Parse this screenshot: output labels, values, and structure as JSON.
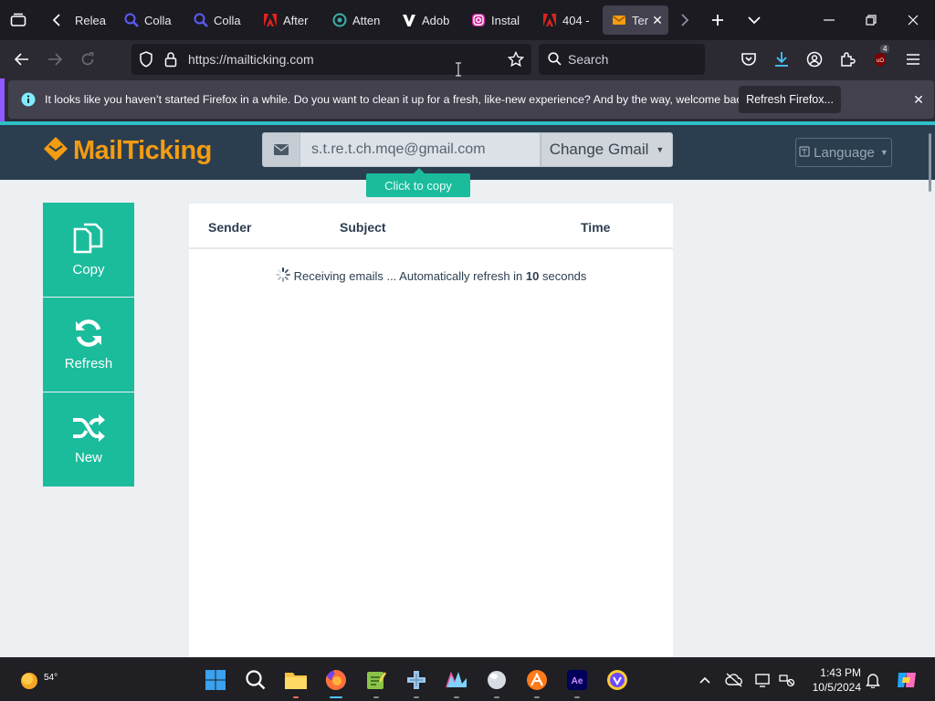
{
  "browser": {
    "tabs": [
      {
        "label": "Relea",
        "icon": "firefox-release-icon",
        "color": "#ffffff"
      },
      {
        "label": "Colla",
        "icon": "search-magnifier-icon",
        "color": "#5b5bff"
      },
      {
        "label": "Colla",
        "icon": "search-magnifier-icon",
        "color": "#5b5bff"
      },
      {
        "label": "After",
        "icon": "adobe-icon",
        "color": "#e0241b"
      },
      {
        "label": "Atten",
        "icon": "circle-logo-icon",
        "color": "#3ab0a8"
      },
      {
        "label": "Adob",
        "icon": "v-logo-icon",
        "color": "#ffffff"
      },
      {
        "label": "Instal",
        "icon": "instagram-icon",
        "color": "#d6249f"
      },
      {
        "label": "404 -",
        "icon": "adobe-icon",
        "color": "#e0241b"
      },
      {
        "label": "Ter",
        "icon": "envelope-icon",
        "color": "#f39c12"
      }
    ],
    "url": "https://mailticking.com",
    "search_placeholder": "Search",
    "extensions_badge": "4",
    "notification": {
      "text": "It looks like you haven’t started Firefox in a while. Do you want to clean it up for a fresh, like-new experience? And by the way, welcome back!",
      "button": "Refresh Firefox..."
    }
  },
  "site": {
    "logo_text": "MailTicking",
    "email": "s.t.re.t.ch.mqe@gmail.com",
    "change_button": "Change Gmail",
    "language_button": "Language",
    "copy_tooltip": "Click to copy",
    "side_buttons": {
      "copy": "Copy",
      "refresh": "Refresh",
      "new": "New"
    },
    "mailbox": {
      "columns": [
        "Sender",
        "Subject",
        "Time"
      ],
      "status_prefix": "Receiving emails ... Automatically refresh in ",
      "countdown": "10",
      "status_suffix": " seconds"
    },
    "brand_color": "#f39c12",
    "accent_color": "#1abc9c",
    "header_color": "#2b3e50"
  },
  "taskbar": {
    "weather_temp": "54°",
    "time": "1:43 PM",
    "date": "10/5/2024"
  }
}
